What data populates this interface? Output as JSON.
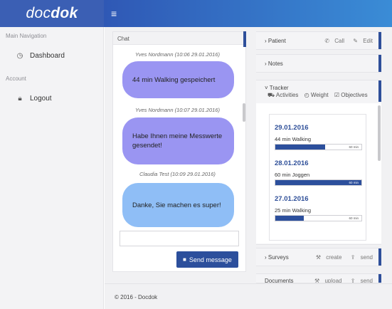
{
  "brand": {
    "part1": "doc",
    "part2": "dok"
  },
  "topbar": {
    "menu_icon": "≡"
  },
  "sidebar": {
    "main_nav_label": "Main Navigation",
    "dashboard_label": "Dashboard",
    "account_label": "Account",
    "logout_label": "Logout"
  },
  "chat": {
    "title": "Chat",
    "messages": [
      {
        "meta": "Yves Nordmann (10:06 29.01.2016)",
        "text": "44 min Walking gespeichert",
        "color": "#9a95f2"
      },
      {
        "meta": "Yves Nordmann (10:07 29.01.2016)",
        "text": "Habe Ihnen meine Messwerte gesendet!",
        "color": "#9a95f2"
      },
      {
        "meta": "Claudia Test (10:09 29.01.2016)",
        "text": "Danke, Sie machen es super!",
        "color": "#8fbef6"
      }
    ],
    "input_value": "",
    "send_label": "Send message"
  },
  "panels": {
    "patient": {
      "title": "› Patient",
      "call": "Call",
      "edit": "Edit"
    },
    "notes": {
      "title": "› Notes"
    },
    "tracker": {
      "title": "˅ Tracker",
      "tabs": [
        "Activities",
        "Weight",
        "Objectives"
      ],
      "entries": [
        {
          "date": "29.01.2016",
          "activity": "44 min Walking",
          "max": "60 min",
          "fraction": 0.58
        },
        {
          "date": "28.01.2016",
          "activity": "60 min Joggen",
          "max": "60 min",
          "fraction": 1.0
        },
        {
          "date": "27.01.2016",
          "activity": "25 min Walking",
          "max": "60 min",
          "fraction": 0.33
        }
      ]
    },
    "surveys": {
      "title": "› Surveys",
      "create": "create",
      "send": "send"
    },
    "documents": {
      "title": "Documents",
      "upload": "upload",
      "send": "send"
    }
  },
  "footer": {
    "text": "© 2016 - Docdok"
  },
  "colors": {
    "accent": "#2e4f9a",
    "primary_button": "#2c4f9c",
    "bubble_patient": "#9a95f2",
    "bubble_doctor": "#8fbef6"
  }
}
